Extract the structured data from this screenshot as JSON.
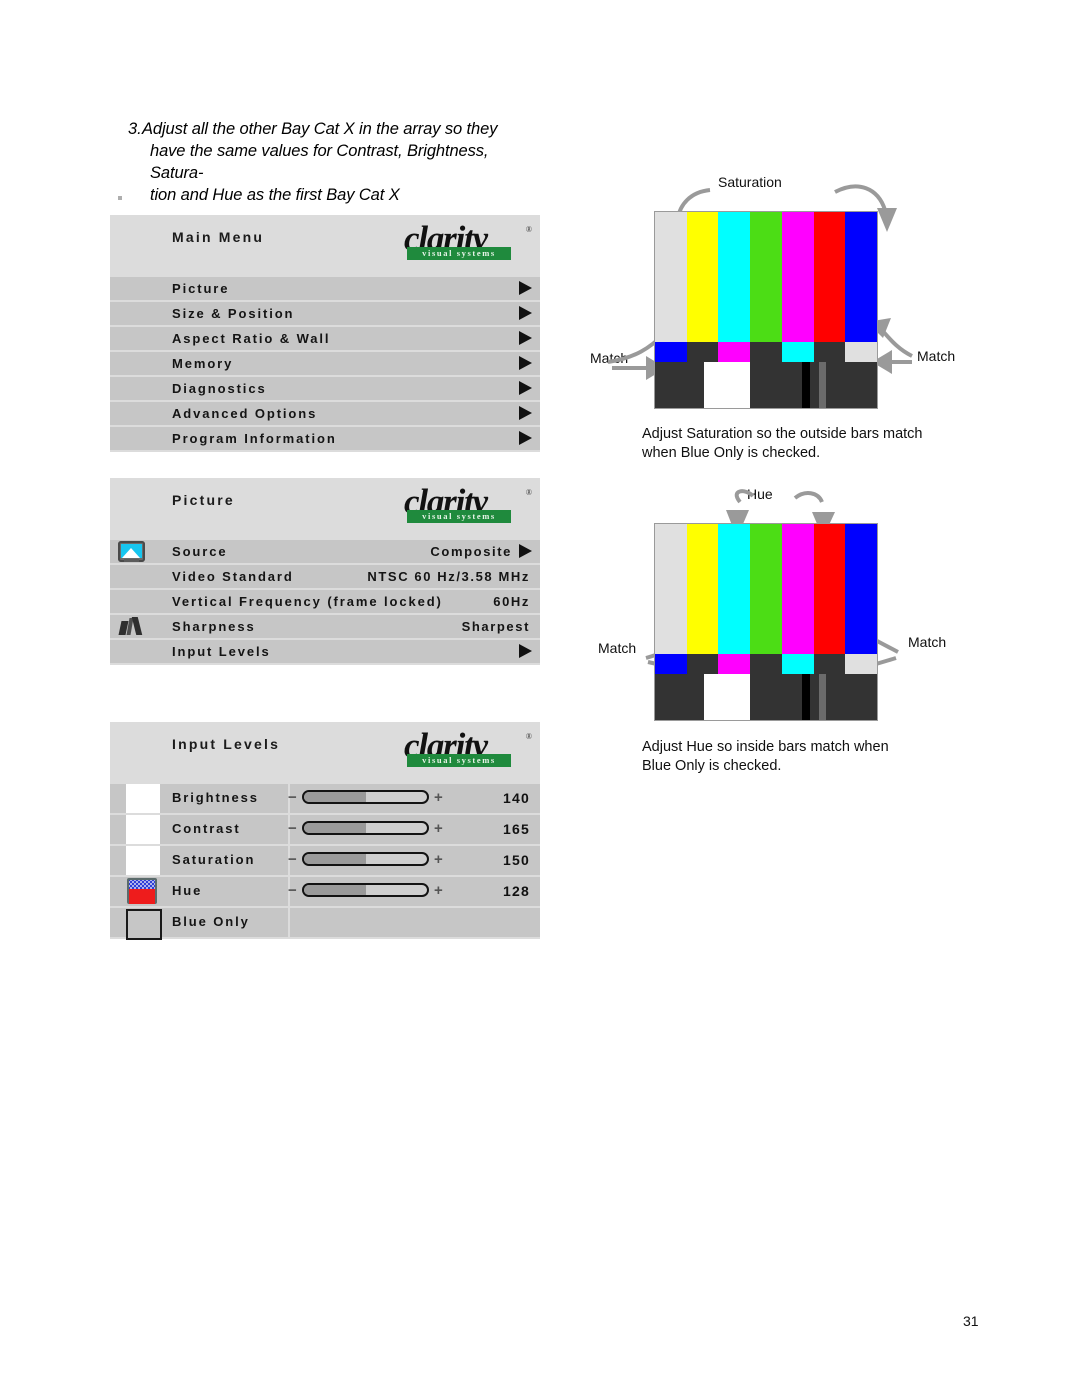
{
  "page": {
    "number": "31"
  },
  "instruction": {
    "number": "3.",
    "line1": "Adjust all the other Bay Cat X in the array so they",
    "line2": "have the same values for Contrast, Brightness, Satura-",
    "line3": "tion and Hue as the first Bay Cat X"
  },
  "logo": {
    "word": "clarity",
    "registered": "®",
    "tagline": "visual systems"
  },
  "main_menu": {
    "title": "Main Menu",
    "items": [
      {
        "label": "Picture",
        "has_arrow": true
      },
      {
        "label": "Size & Position",
        "has_arrow": true
      },
      {
        "label": "Aspect Ratio & Wall",
        "has_arrow": true
      },
      {
        "label": "Memory",
        "has_arrow": true
      },
      {
        "label": "Diagnostics",
        "has_arrow": true
      },
      {
        "label": "Advanced Options",
        "has_arrow": true
      },
      {
        "label": "Program Information",
        "has_arrow": true
      }
    ]
  },
  "picture_menu": {
    "title": "Picture",
    "rows": [
      {
        "label": "Source",
        "value": "Composite",
        "icon": "monitor-picture-icon",
        "has_arrow": true
      },
      {
        "label": "Video Standard",
        "value": "NTSC 60 Hz/3.58 MHz",
        "icon": "",
        "has_arrow": false
      },
      {
        "label": "Vertical Frequency (frame locked)",
        "value": "60Hz",
        "icon": "",
        "has_arrow": false
      },
      {
        "label": "Sharpness",
        "value": "Sharpest",
        "icon": "sharpness-icon",
        "has_arrow": false
      },
      {
        "label": "Input Levels",
        "value": "",
        "icon": "",
        "has_arrow": true
      }
    ]
  },
  "input_levels_menu": {
    "title": "Input Levels",
    "minus_symbol": "−",
    "plus_symbol": "+",
    "rows": [
      {
        "label": "Brightness",
        "value": "140",
        "fill_percent": 50,
        "icon": "white-swatch-icon",
        "type": "slider"
      },
      {
        "label": "Contrast",
        "value": "165",
        "fill_percent": 50,
        "icon": "white-swatch-icon",
        "type": "slider"
      },
      {
        "label": "Saturation",
        "value": "150",
        "fill_percent": 50,
        "icon": "white-swatch-icon",
        "type": "slider"
      },
      {
        "label": "Hue",
        "value": "128",
        "fill_percent": 50,
        "icon": "hue-color-icon",
        "type": "slider"
      },
      {
        "label": "Blue Only",
        "value": "",
        "fill_percent": 0,
        "icon": "checkbox-unchecked-icon",
        "type": "checkbox",
        "checked": false
      }
    ]
  },
  "figures": [
    {
      "id": "saturation-figure",
      "top_label": "Saturation",
      "left_label": "Match",
      "right_label": "Match",
      "caption": "Adjust Saturation so the outside bars match\nwhen Blue Only is checked."
    },
    {
      "id": "hue-figure",
      "top_label": "Hue",
      "left_label": "Match",
      "right_label": "Match",
      "caption": "Adjust Hue so inside bars match when\nBlue Only is checked."
    }
  ],
  "colorbar_pattern": {
    "row1_colors": [
      "#e0e0e0",
      "#ffff00",
      "#00ffff",
      "#4cdd15",
      "#ff00ff",
      "#ff0000",
      "#0000ff"
    ],
    "row2_colors": [
      "#0000ff",
      "#333333",
      "#ff00ff",
      "#333333",
      "#00ffff",
      "#333333",
      "#e0e0e0"
    ],
    "row3_segments": [
      {
        "color": "#333333",
        "width_percent": 22
      },
      {
        "color": "#ffffff",
        "width_percent": 21
      },
      {
        "color": "#333333",
        "width_percent": 23
      },
      {
        "color": "#000000",
        "width_percent": 4
      },
      {
        "color": "#333333",
        "width_percent": 4
      },
      {
        "color": "#6b6b6b",
        "width_percent": 3
      },
      {
        "color": "#333333",
        "width_percent": 23
      }
    ]
  },
  "colors": {
    "arrow_gray": "#9a9a9a",
    "menu_header_bg": "#dcdcdc",
    "menu_row_bg": "#c6c6c6",
    "logo_green": "#1f8a3d"
  }
}
